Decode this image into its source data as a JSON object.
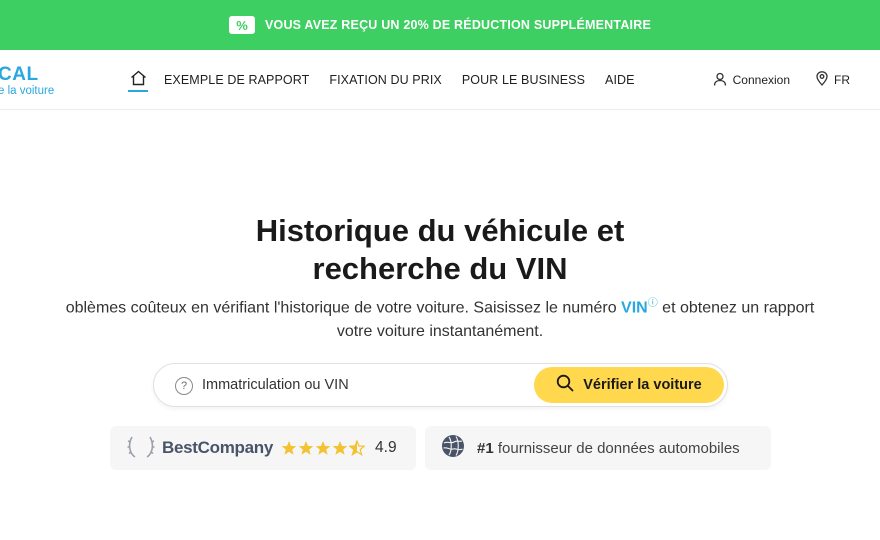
{
  "promo": {
    "icon": "discount-tag-icon",
    "text": "VOUS AVEZ REÇU UN 20% DE RÉDUCTION SUPPLÉMENTAIRE",
    "color": "#3ecf62"
  },
  "logo": {
    "main": "CAL",
    "sub": "e la voiture",
    "color": "#2aa7df"
  },
  "nav": {
    "home_icon": "home-icon",
    "items": [
      "EXEMPLE DE RAPPORT",
      "FIXATION DU PRIX",
      "POUR LE BUSINESS",
      "AIDE"
    ]
  },
  "header_right": {
    "login": "Connexion",
    "language": "FR"
  },
  "hero": {
    "title_line1": "Historique du véhicule et",
    "title_line2": "recherche du VIN",
    "desc_line1_a": "oblèmes coûteux en vérifiant l'historique de votre voiture. Saisissez le numéro ",
    "vin": "VIN",
    "desc_line1_b": " et obtenez un rapport",
    "desc_line2": "votre voiture instantanément."
  },
  "search": {
    "placeholder": "Immatriculation ou VIN",
    "button_label": "Vérifier la voiture",
    "button_color": "#ffd84d"
  },
  "badges": {
    "best_company": {
      "name": "BestCompany",
      "rating": "4.9",
      "stars": 4.5
    },
    "provider": {
      "rank": "#1",
      "text": " fournisseur de données automobiles"
    }
  }
}
